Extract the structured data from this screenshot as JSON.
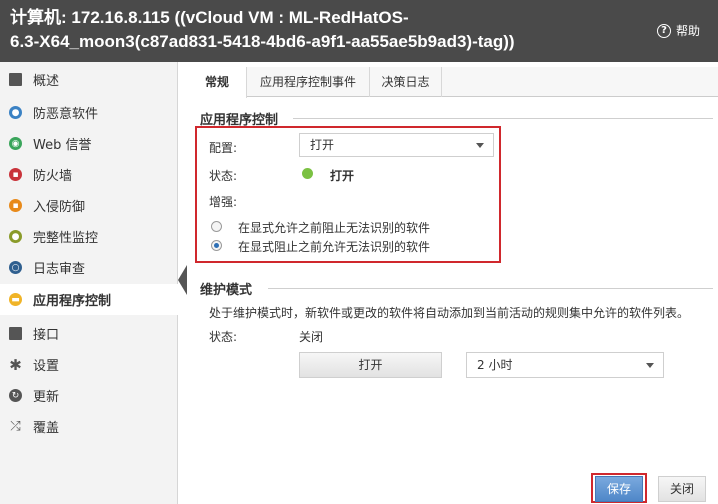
{
  "header": {
    "title_label": "计算机:",
    "title_line1": "172.16.8.115 ((vCloud VM : ML-RedHatOS-",
    "title_line2": "6.3-X64_moon3(c87ad831-5418-4bd6-a9f1-aa55ae5b9ad3)-tag))",
    "help_label": "帮助",
    "help_icon": "?"
  },
  "sidebar": {
    "items": [
      {
        "label": "概述",
        "icon": "overview-icon",
        "color": "#555555"
      },
      {
        "label": "防恶意软件",
        "icon": "anti-malware-icon",
        "color": "#3b82c4"
      },
      {
        "label": "Web 信誉",
        "icon": "web-reputation-icon",
        "color": "#3aa55b"
      },
      {
        "label": "防火墙",
        "icon": "firewall-icon",
        "color": "#c9333a"
      },
      {
        "label": "入侵防御",
        "icon": "intrusion-prevention-icon",
        "color": "#e88a1a"
      },
      {
        "label": "完整性监控",
        "icon": "integrity-monitoring-icon",
        "color": "#8a9b2a"
      },
      {
        "label": "日志审查",
        "icon": "log-inspection-icon",
        "color": "#2f5f8f"
      },
      {
        "label": "应用程序控制",
        "icon": "application-control-icon",
        "color": "#f0b428"
      },
      {
        "label": "接口",
        "icon": "interfaces-icon",
        "color": "#555555"
      },
      {
        "label": "设置",
        "icon": "settings-gear-icon",
        "color": "#555555"
      },
      {
        "label": "更新",
        "icon": "updates-icon",
        "color": "#555555"
      },
      {
        "label": "覆盖",
        "icon": "overrides-icon",
        "color": "#555555"
      }
    ],
    "active_index": 7
  },
  "tabs": [
    {
      "label": "常规"
    },
    {
      "label": "应用程序控制事件"
    },
    {
      "label": "决策日志"
    }
  ],
  "app_control": {
    "section_title": "应用程序控制",
    "config_label": "配置:",
    "config_value": "打开",
    "status_label": "状态:",
    "status_value": "打开",
    "enhance_label": "增强:",
    "options": [
      {
        "label": "在显式允许之前阻止无法识别的软件",
        "checked": false
      },
      {
        "label": "在显式阻止之前允许无法识别的软件",
        "checked": true
      }
    ]
  },
  "maintenance": {
    "section_title": "维护模式",
    "description": "处于维护模式时，新软件或更改的软件将自动添加到当前活动的规则集中允许的软件列表。",
    "status_label": "状态:",
    "status_value": "关闭",
    "on_button": "打开",
    "duration_value": "2 小时"
  },
  "footer": {
    "save_label": "保存",
    "close_label": "关闭"
  },
  "colors": {
    "header_bg": "#4a4a4a",
    "highlight": "#d0282d",
    "status_on": "#7bc142",
    "primary": "#4f87c8"
  }
}
